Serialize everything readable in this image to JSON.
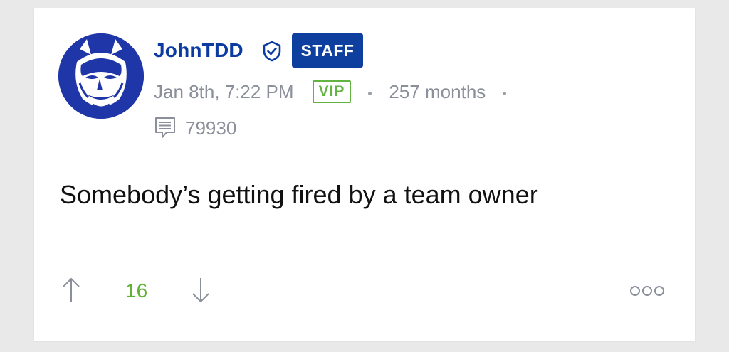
{
  "post": {
    "author": {
      "username": "JohnTDD",
      "role_badge": "STAFF",
      "membership_badge": "VIP",
      "tenure": "257 months",
      "post_count": "79930"
    },
    "timestamp": "Jan 8th, 7:22 PM",
    "body": "Somebody’s getting fired by a team owner",
    "score": "16"
  },
  "icons": {
    "verified": "shield-check-icon",
    "posts": "comment-icon",
    "upvote": "arrow-up-icon",
    "downvote": "arrow-down-icon",
    "more": "more-options-icon"
  },
  "colors": {
    "username": "#0b3aa0",
    "staff_badge_bg": "#0e3f9e",
    "vip_badge": "#62b342",
    "score": "#5fb033",
    "meta_text": "#8a8f99",
    "page_bg": "#e9e9ea"
  }
}
